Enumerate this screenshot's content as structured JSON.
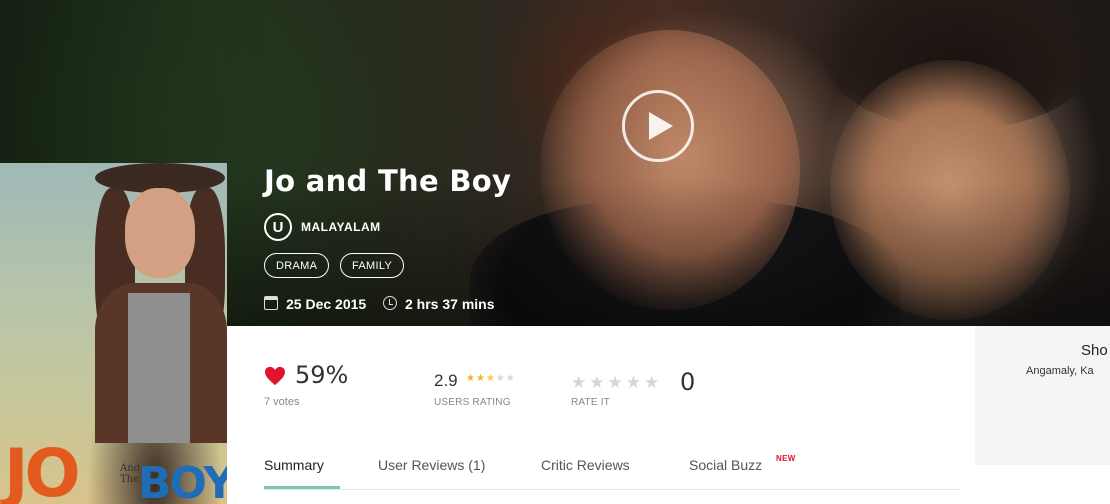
{
  "hero": {
    "play_label": ""
  },
  "poster": {
    "logo_jo": "JO",
    "logo_and": "And\nThe",
    "logo_boy": "BOY"
  },
  "movie": {
    "title": "Jo and The Boy",
    "certificate": "U",
    "language": "MALAYALAM",
    "genres": [
      "DRAMA",
      "FAMILY"
    ],
    "release_date": "25 Dec 2015",
    "runtime": "2 hrs 37 mins"
  },
  "ratings": {
    "like_percent": "59%",
    "votes": "7 votes",
    "users_rating_value": "2.9",
    "users_rating_stars": 2.5,
    "users_rating_label": "USERS RATING",
    "rate_it_label": "RATE IT",
    "my_rating": "0",
    "colors": {
      "heart": "#e0152d",
      "star_on": "#f2b51d",
      "star_off": "#d6d6d6"
    }
  },
  "tabs": {
    "items": [
      {
        "label": "Summary"
      },
      {
        "label": "User Reviews (1)"
      },
      {
        "label": "Critic Reviews"
      },
      {
        "label": "Social Buzz"
      }
    ],
    "new_badge": "NEW",
    "accent": "#7cc9a8"
  },
  "side_panel": {
    "title": "Sho",
    "location": "Angamaly, Ka"
  }
}
